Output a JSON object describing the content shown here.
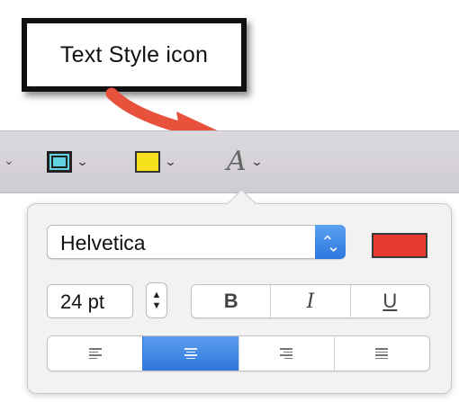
{
  "callout": {
    "text": "Text Style icon"
  },
  "toolbar": {
    "items": [
      {
        "icon": "shape-style-icon",
        "chevron": "⌄"
      },
      {
        "icon": "fill-color-icon",
        "fill_color": "#f7e11c",
        "chevron": "⌄"
      },
      {
        "icon": "text-style-icon",
        "glyph": "A",
        "chevron": "⌄"
      }
    ]
  },
  "popover": {
    "font_family": "Helvetica",
    "font_color": "#e63a2e",
    "font_size": "24 pt",
    "style_buttons": [
      "B",
      "I",
      "U"
    ],
    "alignment": {
      "options": [
        "left",
        "center",
        "right",
        "justify"
      ],
      "selected": "center"
    }
  },
  "colors": {
    "arrow": "#e8523d",
    "accent": "#2f76dc"
  }
}
